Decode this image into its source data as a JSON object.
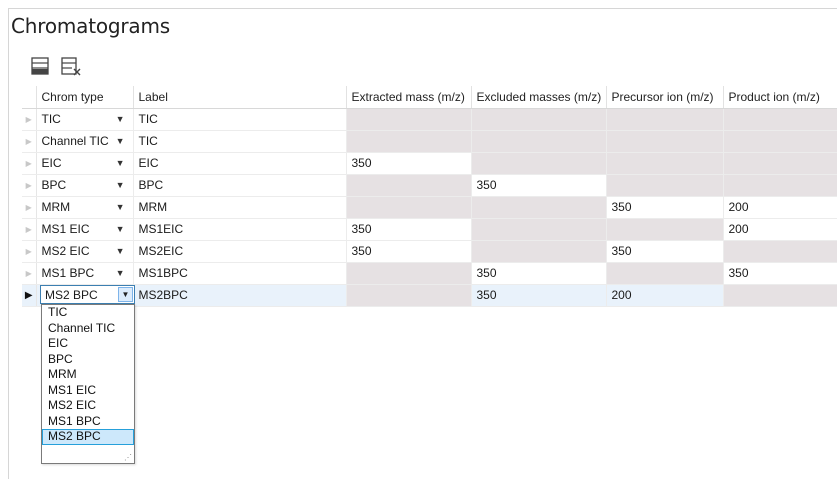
{
  "title": "Chromatograms",
  "toolbar": {
    "add_icon": "add-row-icon",
    "remove_icon": "delete-row-icon"
  },
  "columns": [
    "Chrom type",
    "Label",
    "Extracted mass (m/z)",
    "Excluded masses (m/z)",
    "Precursor ion (m/z)",
    "Product ion (m/z)"
  ],
  "rows": [
    {
      "type": "TIC",
      "label": "TIC",
      "extracted": "",
      "excluded": "",
      "precursor": "",
      "product": ""
    },
    {
      "type": "Channel TIC",
      "label": "TIC",
      "extracted": "",
      "excluded": "",
      "precursor": "",
      "product": ""
    },
    {
      "type": "EIC",
      "label": "EIC",
      "extracted": "350",
      "excluded": "",
      "precursor": "",
      "product": ""
    },
    {
      "type": "BPC",
      "label": "BPC",
      "extracted": "",
      "excluded": "350",
      "precursor": "",
      "product": ""
    },
    {
      "type": "MRM",
      "label": "MRM",
      "extracted": "",
      "excluded": "",
      "precursor": "350",
      "product": "200"
    },
    {
      "type": "MS1 EIC",
      "label": "MS1EIC",
      "extracted": "350",
      "excluded": "",
      "precursor": "",
      "product": "200"
    },
    {
      "type": "MS2 EIC",
      "label": "MS2EIC",
      "extracted": "350",
      "excluded": "",
      "precursor": "350",
      "product": ""
    },
    {
      "type": "MS1 BPC",
      "label": "MS1BPC",
      "extracted": "",
      "excluded": "350",
      "precursor": "",
      "product": "350"
    },
    {
      "type": "MS2 BPC",
      "label": "MS2BPC",
      "extracted": "",
      "excluded": "350",
      "precursor": "200",
      "product": ""
    }
  ],
  "combo": {
    "value": "MS2 BPC"
  },
  "dropdown_options": [
    "TIC",
    "Channel TIC",
    "EIC",
    "BPC",
    "MRM",
    "MS1 EIC",
    "MS2 EIC",
    "MS1 BPC",
    "MS2 BPC"
  ],
  "colors": {
    "disabled_cell": "#e6e1e3",
    "selected_row": "#e9f2fb",
    "highlight": "#cde8fb"
  }
}
